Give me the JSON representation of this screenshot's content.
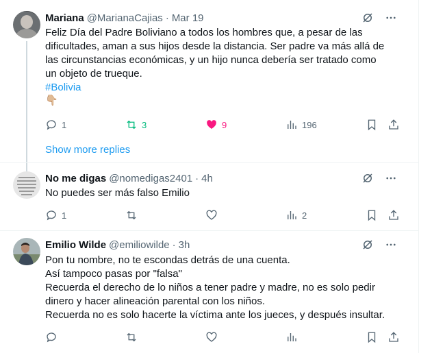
{
  "tweets": [
    {
      "name": "Mariana",
      "handle": "@MarianaCajias",
      "separator": "·",
      "time": "Mar 19",
      "lines": [
        "Feliz Día del Padre Boliviano a todos los hombres que, a pesar de las",
        "dificultades, aman a sus hijos desde la distancia. Ser padre va más allá de",
        "las circunstancias económicas, y un hijo nunca debería ser tratado como",
        "un objeto de trueque."
      ],
      "hashtag": "#Bolivia",
      "emoji": "👇🏼",
      "replies": "1",
      "reposts": "3",
      "likes": "9",
      "views": "196"
    },
    {
      "name": "No me digas",
      "handle": "@nomedigas2401",
      "separator": "·",
      "time": "4h",
      "lines": [
        "No puedes ser más falso Emilio"
      ],
      "replies": "1",
      "reposts": "",
      "likes": "",
      "views": "2"
    },
    {
      "name": "Emilio Wilde",
      "handle": "@emiliowilde",
      "separator": "·",
      "time": "3h",
      "lines": [
        "Pon tu nombre, no te escondas detrás de una cuenta.",
        "Así tampoco pasas por \"falsa\"",
        "Recuerda el derecho de lo niños a tener padre y madre, no es solo pedir",
        "dinero y hacer alineación parental con los niños.",
        "Recuerda no es solo hacerte la víctima ante los jueces, y después insultar."
      ],
      "replies": "",
      "reposts": "",
      "likes": "",
      "views": ""
    }
  ],
  "show_more_replies": "Show more replies",
  "colors": {
    "accent": "#1d9bf0",
    "repost_active": "#00ba7c",
    "like_active": "#f91880",
    "muted": "#536471",
    "divider": "#eff3f4"
  },
  "icons": [
    "grok-icon",
    "more-icon",
    "reply-icon",
    "repost-icon",
    "like-icon",
    "views-icon",
    "bookmark-icon",
    "share-icon"
  ]
}
